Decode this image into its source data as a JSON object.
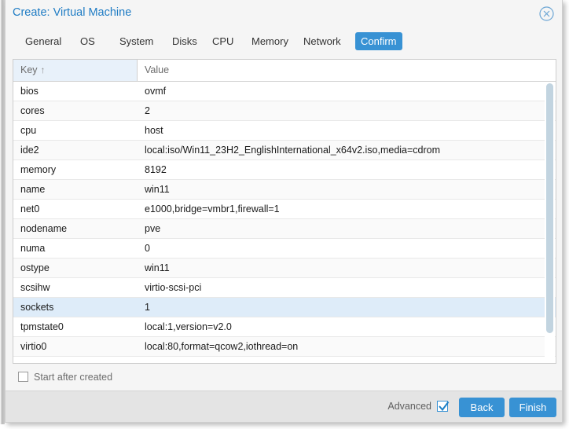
{
  "dialog": {
    "title": "Create: Virtual Machine",
    "close_icon": "close-circle-icon"
  },
  "tabs": [
    {
      "label": "General",
      "active": false
    },
    {
      "label": "OS",
      "active": false
    },
    {
      "label": "System",
      "active": false
    },
    {
      "label": "Disks",
      "active": false
    },
    {
      "label": "CPU",
      "active": false
    },
    {
      "label": "Memory",
      "active": false
    },
    {
      "label": "Network",
      "active": false
    },
    {
      "label": "Confirm",
      "active": true
    }
  ],
  "grid": {
    "columns": [
      {
        "label": "Key",
        "sorted": true,
        "sort_direction": "↑"
      },
      {
        "label": "Value",
        "sorted": false,
        "sort_direction": ""
      }
    ],
    "rows": [
      {
        "key": "bios",
        "value": "ovmf",
        "selected": false
      },
      {
        "key": "cores",
        "value": "2",
        "selected": false
      },
      {
        "key": "cpu",
        "value": "host",
        "selected": false
      },
      {
        "key": "ide2",
        "value": "local:iso/Win11_23H2_EnglishInternational_x64v2.iso,media=cdrom",
        "selected": false
      },
      {
        "key": "memory",
        "value": "8192",
        "selected": false
      },
      {
        "key": "name",
        "value": "win11",
        "selected": false
      },
      {
        "key": "net0",
        "value": "e1000,bridge=vmbr1,firewall=1",
        "selected": false
      },
      {
        "key": "nodename",
        "value": "pve",
        "selected": false
      },
      {
        "key": "numa",
        "value": "0",
        "selected": false
      },
      {
        "key": "ostype",
        "value": "win11",
        "selected": false
      },
      {
        "key": "scsihw",
        "value": "virtio-scsi-pci",
        "selected": false
      },
      {
        "key": "sockets",
        "value": "1",
        "selected": true
      },
      {
        "key": "tpmstate0",
        "value": "local:1,version=v2.0",
        "selected": false
      },
      {
        "key": "virtio0",
        "value": "local:80,format=qcow2,iothread=on",
        "selected": false
      }
    ]
  },
  "options": {
    "start_after_created_label": "Start after created",
    "start_after_created_checked": false,
    "advanced_label": "Advanced",
    "advanced_checked": true
  },
  "footer": {
    "back_label": "Back",
    "finish_label": "Finish"
  },
  "colors": {
    "accent": "#3892d4",
    "title": "#1f7cc4",
    "selected_row": "#deecf9",
    "sorted_header": "#e8f1fa"
  }
}
